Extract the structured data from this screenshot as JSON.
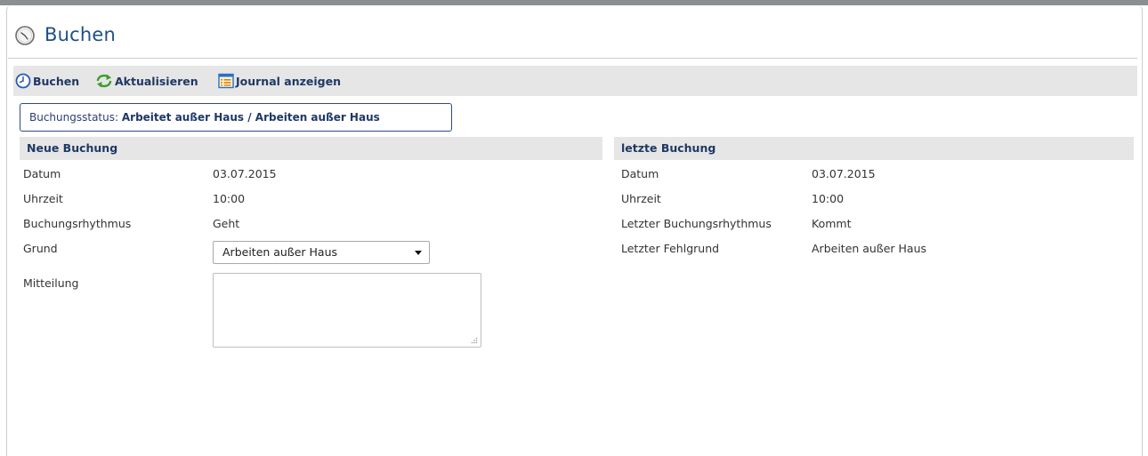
{
  "page": {
    "title": "Buchen"
  },
  "toolbar": {
    "buchen_label": "Buchen",
    "aktualisieren_label": "Aktualisieren",
    "journal_label": "Journal anzeigen"
  },
  "status": {
    "label": "Buchungsstatus:",
    "value": "Arbeitet außer Haus / Arbeiten außer Haus"
  },
  "neue_buchung": {
    "heading": "Neue Buchung",
    "datum_label": "Datum",
    "datum_value": "03.07.2015",
    "uhrzeit_label": "Uhrzeit",
    "uhrzeit_value": "10:00",
    "rhythmus_label": "Buchungsrhythmus",
    "rhythmus_value": "Geht",
    "grund_label": "Grund",
    "grund_selected": "Arbeiten außer Haus",
    "mitteilung_label": "Mitteilung",
    "mitteilung_value": ""
  },
  "letzte_buchung": {
    "heading": "letzte Buchung",
    "datum_label": "Datum",
    "datum_value": "03.07.2015",
    "uhrzeit_label": "Uhrzeit",
    "uhrzeit_value": "10:00",
    "rhythmus_label": "Letzter Buchungsrhythmus",
    "rhythmus_value": "Kommt",
    "fehlgrund_label": "Letzter Fehlgrund",
    "fehlgrund_value": "Arbeiten außer Haus"
  },
  "icons": {
    "header": "clock-icon",
    "buchen": "clock-arrow-icon",
    "aktualisieren": "refresh-icon",
    "journal": "journal-list-icon"
  },
  "colors": {
    "title": "#1f4f86",
    "accent_text": "#1f3864",
    "section_bg": "#e6e6e6",
    "status_border": "#2f4a8a"
  }
}
